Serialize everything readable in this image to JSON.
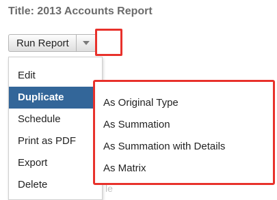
{
  "page": {
    "title": "Title: 2013 Accounts Report"
  },
  "toolbar": {
    "run_label": "Run Report",
    "caret_icon": "chevron-down-icon"
  },
  "menu": {
    "items": [
      {
        "label": "Edit",
        "active": false
      },
      {
        "label": "Duplicate",
        "active": true
      },
      {
        "label": "Schedule",
        "active": false
      },
      {
        "label": "Print as PDF",
        "active": false
      },
      {
        "label": "Export",
        "active": false
      },
      {
        "label": "Delete",
        "active": false
      }
    ]
  },
  "submenu": {
    "items": [
      {
        "label": "As Original Type"
      },
      {
        "label": "As Summation"
      },
      {
        "label": "As Summation with Details"
      },
      {
        "label": "As Matrix"
      }
    ]
  },
  "background": {
    "ghost_text": "le"
  },
  "colors": {
    "active_item_bg": "#336699",
    "highlight_border": "#e8312b",
    "title_text": "#6b6b6b"
  }
}
